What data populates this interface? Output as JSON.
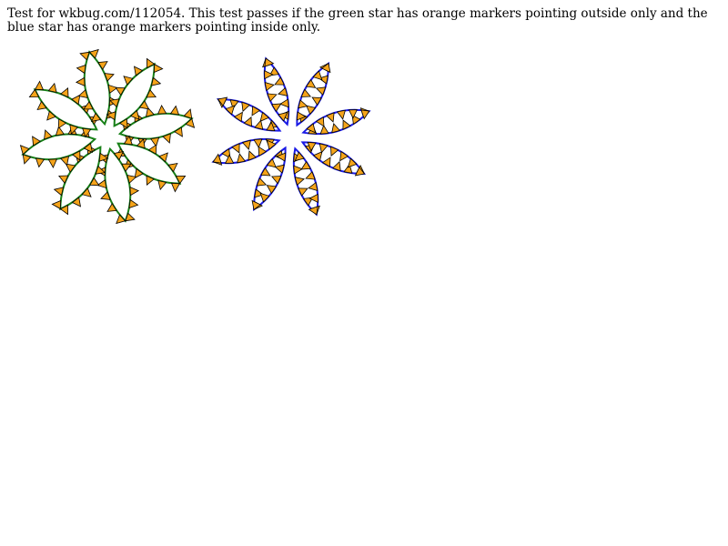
{
  "test": {
    "description": "Test for wkbug.com/112054. This test passes if the green star has orange markers pointing outside only and the blue star has orange markers pointing inside only."
  },
  "colors": {
    "green_star_stroke": "#178017",
    "green_star_fill": "#ffffff",
    "blue_star_stroke": "#1a1ae6",
    "blue_star_fill": "none",
    "marker_fill": "#f5a41a",
    "marker_stroke": "#000000"
  },
  "stars": [
    {
      "name": "green star",
      "petals": 8,
      "marker_direction": "outside"
    },
    {
      "name": "blue star",
      "petals": 8,
      "marker_direction": "inside"
    }
  ]
}
